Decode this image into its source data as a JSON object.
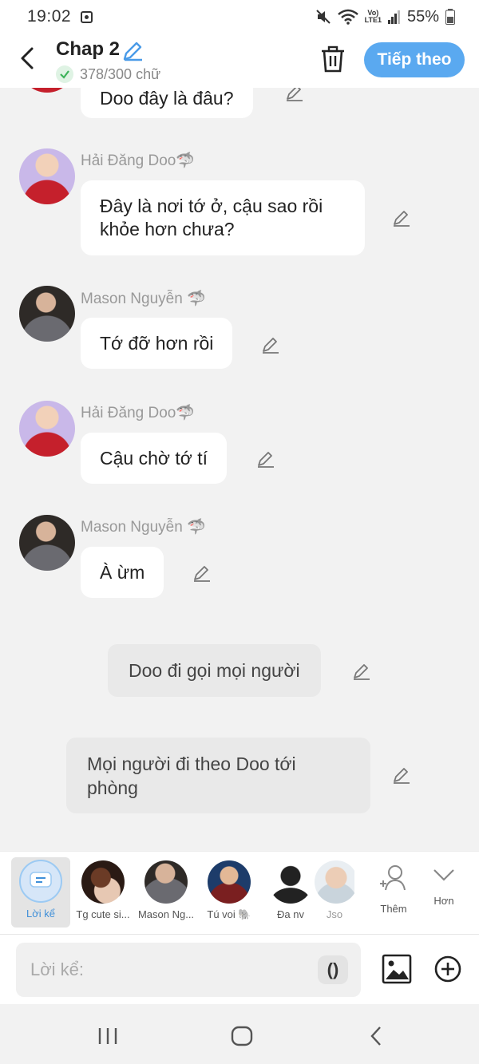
{
  "status": {
    "time": "19:02",
    "battery": "55%",
    "network_top": "Vo)",
    "network_bottom": "LTE1"
  },
  "header": {
    "title": "Chap 2",
    "word_count": "378/300 chữ",
    "next_label": "Tiếp theo"
  },
  "messages": [
    {
      "type": "bubble",
      "text": "Doo đây là đâu?"
    },
    {
      "type": "bubble",
      "speaker": "Hải Đăng Doo🦈",
      "text": "Đây là nơi tớ ở, cậu sao rồi khỏe hơn chưa?"
    },
    {
      "type": "bubble",
      "speaker": "Mason Nguyễn 🦈",
      "text": "Tớ đỡ hơn rồi"
    },
    {
      "type": "bubble",
      "speaker": "Hải Đăng Doo🦈",
      "text": "Cậu chờ tớ tí"
    },
    {
      "type": "bubble",
      "speaker": "Mason Nguyễn 🦈",
      "text": "À ừm"
    },
    {
      "type": "narration",
      "text": "Doo đi gọi mọi người"
    },
    {
      "type": "narration",
      "text": "Mọi người đi theo Doo tới phòng"
    }
  ],
  "characters": [
    {
      "label": "Lời kể",
      "selected": true
    },
    {
      "label": "Tg cute si..."
    },
    {
      "label": "Mason Ng..."
    },
    {
      "label": "Tú voi 🐘"
    },
    {
      "label": "Đa nv"
    },
    {
      "label": "Jso"
    }
  ],
  "actions": {
    "more_label": "Thêm",
    "collapse_label": "Hơn"
  },
  "composer": {
    "placeholder": "Lời kể:",
    "paren_label": "()"
  },
  "colors": {
    "accent": "#5aa9f0",
    "background": "#f2f2f2",
    "bubble": "#ffffff",
    "narration": "#e9e9e9"
  }
}
